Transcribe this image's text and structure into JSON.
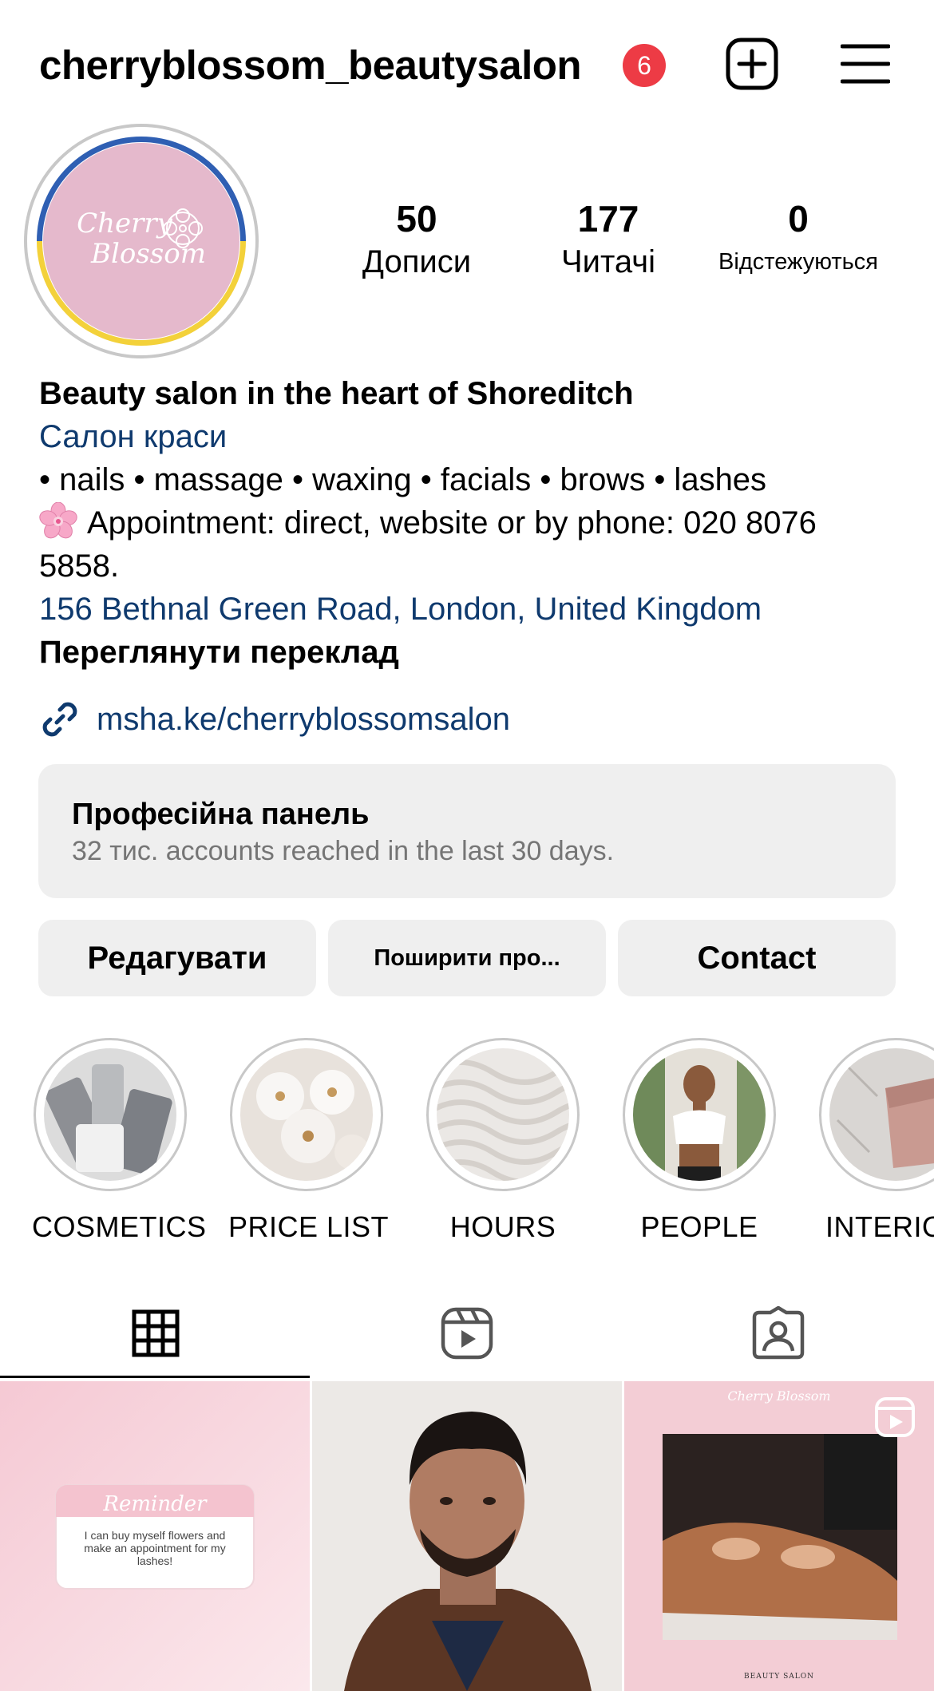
{
  "header": {
    "username": "cherryblossom_beautysalon",
    "notification_count": "6",
    "create_icon": "plus-square-icon",
    "menu_icon": "hamburger-menu-icon"
  },
  "avatar": {
    "logo_line1": "Cherry",
    "logo_line2": "Blossom"
  },
  "stats": [
    {
      "value": "50",
      "label": "Дописи"
    },
    {
      "value": "177",
      "label": "Читачі"
    },
    {
      "value": "0",
      "label": "Відстежуються"
    }
  ],
  "bio": {
    "name": "Beauty salon in the heart of Shoreditch",
    "category": "Салон краси",
    "services": "• nails • massage • waxing • facials • brows • lashes",
    "appointment": "Appointment: direct, website or by phone: 020 8076 5858.",
    "address": "156 Bethnal Green Road, London, United Kingdom",
    "translate": "Переглянути переклад"
  },
  "link": {
    "url": "msha.ke/cherryblossomsalon"
  },
  "dashboard": {
    "title": "Професійна панель",
    "subtitle": "32 тис. accounts reached in the last 30 days."
  },
  "buttons": {
    "edit": "Редагувати",
    "share": "Поширити про...",
    "contact": "Contact"
  },
  "highlights": [
    {
      "label": "COSMETICS"
    },
    {
      "label": "PRICE LIST"
    },
    {
      "label": "HOURS"
    },
    {
      "label": "PEOPLE"
    },
    {
      "label": "INTERIOR"
    }
  ],
  "posts": {
    "reminder_title": "Reminder",
    "reminder_text": "I can buy myself flowers and make an appointment for my lashes!",
    "massage_header": "Cherry Blossom",
    "massage_footer": "BEAUTY SALON"
  },
  "colors": {
    "accent_link": "#0f3a6e",
    "badge": "#ed3b45",
    "avatar_pink": "#e5b9cc",
    "ring_blue": "#2f5fb3",
    "ring_yellow": "#f3d13a",
    "button_bg": "#efefef"
  }
}
